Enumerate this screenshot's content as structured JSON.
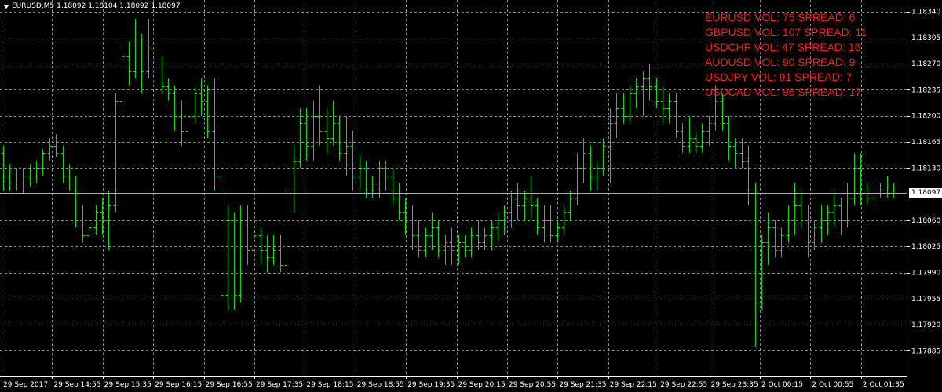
{
  "header": {
    "symbol": "EURUSD,M5",
    "ohlc": "1.18092 1.18104 1.18092 1.18097"
  },
  "overlay": [
    "EURUSD VOL: 75 SPREAD: 6",
    "GBPUSD VOL: 107 SPREAD: 11",
    "USDCHF VOL: 47 SPREAD: 16",
    "AUDUSD VOL: 90 SPREAD: 9",
    "USDJPY VOL: 91 SPREAD: 7",
    "USDCAD VOL: 96 SPREAD: 17"
  ],
  "colors": {
    "background": "#000000",
    "bars": "#00e600",
    "grid": "#8a8a8a",
    "overlay_text": "#ff1a1a",
    "axis": "#ffffff"
  },
  "chart_data": {
    "type": "bar",
    "style": "ohlc",
    "grid": true,
    "current_price": 1.18097,
    "current_price_label": "1.18097",
    "ylim": [
      1.17885,
      1.18348
    ],
    "y_ticks": [
      "1.18340",
      "1.18305",
      "1.18270",
      "1.18235",
      "1.18200",
      "1.18165",
      "1.18130",
      "1.18060",
      "1.18025",
      "1.17990",
      "1.17955",
      "1.17920",
      "1.17885"
    ],
    "x_ticks": [
      "29 Sep 2017",
      "29 Sep 14:55",
      "29 Sep 15:35",
      "29 Sep 16:15",
      "29 Sep 16:55",
      "29 Sep 17:35",
      "29 Sep 18:15",
      "29 Sep 18:55",
      "29 Sep 19:35",
      "29 Sep 20:15",
      "29 Sep 20:55",
      "29 Sep 21:35",
      "29 Sep 22:15",
      "29 Sep 22:55",
      "29 Sep 23:35",
      "2 Oct 00:15",
      "2 Oct 00:55",
      "2 Oct 01:35"
    ],
    "bars": [
      [
        1.1815,
        1.1816,
        1.181,
        1.1812
      ],
      [
        1.1812,
        1.18135,
        1.181,
        1.18125
      ],
      [
        1.18125,
        1.1813,
        1.181,
        1.1811
      ],
      [
        1.1811,
        1.1813,
        1.18095,
        1.1812
      ],
      [
        1.1812,
        1.18135,
        1.18105,
        1.18115
      ],
      [
        1.18115,
        1.1814,
        1.1811,
        1.1813
      ],
      [
        1.1813,
        1.18155,
        1.1812,
        1.1815
      ],
      [
        1.1815,
        1.1817,
        1.1814,
        1.1816
      ],
      [
        1.1816,
        1.18175,
        1.18145,
        1.1815
      ],
      [
        1.1815,
        1.1816,
        1.1811,
        1.1812
      ],
      [
        1.1812,
        1.18135,
        1.181,
        1.1811
      ],
      [
        1.1811,
        1.1812,
        1.1805,
        1.1806
      ],
      [
        1.1806,
        1.1808,
        1.1803,
        1.1804
      ],
      [
        1.1804,
        1.1806,
        1.1802,
        1.1805
      ],
      [
        1.1805,
        1.1808,
        1.1804,
        1.1807
      ],
      [
        1.1807,
        1.1809,
        1.1804,
        1.1806
      ],
      [
        1.1806,
        1.181,
        1.1802,
        1.1808
      ],
      [
        1.1808,
        1.1823,
        1.1807,
        1.1822
      ],
      [
        1.1822,
        1.1829,
        1.1821,
        1.1828
      ],
      [
        1.1828,
        1.183,
        1.1824,
        1.1826
      ],
      [
        1.1826,
        1.1833,
        1.1825,
        1.1827
      ],
      [
        1.1827,
        1.1831,
        1.1823,
        1.1826
      ],
      [
        1.1826,
        1.1833,
        1.1825,
        1.1829
      ],
      [
        1.1829,
        1.1832,
        1.1825,
        1.1827
      ],
      [
        1.1827,
        1.1828,
        1.1823,
        1.1824
      ],
      [
        1.1824,
        1.1825,
        1.1822,
        1.1823
      ],
      [
        1.1823,
        1.1824,
        1.1818,
        1.182
      ],
      [
        1.182,
        1.1822,
        1.1816,
        1.1818
      ],
      [
        1.1818,
        1.1822,
        1.1817,
        1.182
      ],
      [
        1.182,
        1.1824,
        1.1819,
        1.1823
      ],
      [
        1.1823,
        1.1825,
        1.182,
        1.1822
      ],
      [
        1.1822,
        1.1824,
        1.1817,
        1.1818
      ],
      [
        1.1818,
        1.1825,
        1.181,
        1.1812
      ],
      [
        1.1812,
        1.1814,
        1.1792,
        1.1796
      ],
      [
        1.1796,
        1.1808,
        1.1794,
        1.1806
      ],
      [
        1.1806,
        1.1807,
        1.1794,
        1.1796
      ],
      [
        1.1796,
        1.1808,
        1.1795,
        1.1806
      ],
      [
        1.1806,
        1.1808,
        1.18,
        1.1802
      ],
      [
        1.1802,
        1.1806,
        1.1799,
        1.1804
      ],
      [
        1.1804,
        1.1805,
        1.18,
        1.1802
      ],
      [
        1.1802,
        1.1804,
        1.1799,
        1.1801
      ],
      [
        1.1801,
        1.1804,
        1.18,
        1.1802
      ],
      [
        1.1802,
        1.1804,
        1.1799,
        1.18
      ],
      [
        1.18,
        1.1812,
        1.1799,
        1.181
      ],
      [
        1.181,
        1.1816,
        1.1807,
        1.1814
      ],
      [
        1.1814,
        1.1821,
        1.1813,
        1.1819
      ],
      [
        1.1819,
        1.1821,
        1.1814,
        1.1816
      ],
      [
        1.1816,
        1.1822,
        1.1814,
        1.182
      ],
      [
        1.182,
        1.1824,
        1.1816,
        1.1818
      ],
      [
        1.1818,
        1.1821,
        1.1815,
        1.1817
      ],
      [
        1.1817,
        1.1822,
        1.1816,
        1.1819
      ],
      [
        1.1819,
        1.182,
        1.1814,
        1.1815
      ],
      [
        1.1815,
        1.182,
        1.1812,
        1.1816
      ],
      [
        1.1816,
        1.1818,
        1.181,
        1.1812
      ],
      [
        1.1812,
        1.1815,
        1.181,
        1.1813
      ],
      [
        1.1813,
        1.1814,
        1.1809,
        1.181
      ],
      [
        1.181,
        1.1812,
        1.1809,
        1.1811
      ],
      [
        1.1811,
        1.1814,
        1.1809,
        1.1813
      ],
      [
        1.1813,
        1.1814,
        1.181,
        1.1812
      ],
      [
        1.1812,
        1.1813,
        1.1808,
        1.1809
      ],
      [
        1.1809,
        1.1811,
        1.1806,
        1.1807
      ],
      [
        1.1807,
        1.1809,
        1.1804,
        1.1806
      ],
      [
        1.1806,
        1.1808,
        1.1802,
        1.1804
      ],
      [
        1.1804,
        1.1806,
        1.1801,
        1.1802
      ],
      [
        1.1802,
        1.1805,
        1.1801,
        1.1804
      ],
      [
        1.1804,
        1.1807,
        1.1802,
        1.1805
      ],
      [
        1.1805,
        1.1806,
        1.1801,
        1.1802
      ],
      [
        1.1802,
        1.1804,
        1.18,
        1.1803
      ],
      [
        1.1803,
        1.1805,
        1.18,
        1.1802
      ],
      [
        1.1802,
        1.1804,
        1.18,
        1.1803
      ],
      [
        1.1803,
        1.1804,
        1.1801,
        1.1802
      ],
      [
        1.1802,
        1.1805,
        1.1801,
        1.1804
      ],
      [
        1.1804,
        1.1806,
        1.1802,
        1.1803
      ],
      [
        1.1803,
        1.1805,
        1.1802,
        1.1804
      ],
      [
        1.1804,
        1.1806,
        1.1802,
        1.1805
      ],
      [
        1.1805,
        1.1807,
        1.1803,
        1.1806
      ],
      [
        1.1806,
        1.1808,
        1.1804,
        1.1807
      ],
      [
        1.1807,
        1.181,
        1.1805,
        1.1809
      ],
      [
        1.1809,
        1.1811,
        1.1806,
        1.1808
      ],
      [
        1.1808,
        1.181,
        1.1806,
        1.1809
      ],
      [
        1.1809,
        1.1812,
        1.1806,
        1.1808
      ],
      [
        1.1808,
        1.1809,
        1.1804,
        1.1805
      ],
      [
        1.1805,
        1.1808,
        1.1803,
        1.1806
      ],
      [
        1.1806,
        1.1808,
        1.1803,
        1.1804
      ],
      [
        1.1804,
        1.1806,
        1.1803,
        1.1805
      ],
      [
        1.1805,
        1.1808,
        1.1804,
        1.1807
      ],
      [
        1.1807,
        1.181,
        1.1806,
        1.1809
      ],
      [
        1.1809,
        1.1815,
        1.1808,
        1.1813
      ],
      [
        1.1813,
        1.1817,
        1.1811,
        1.1815
      ],
      [
        1.1815,
        1.1816,
        1.181,
        1.1812
      ],
      [
        1.1812,
        1.1814,
        1.181,
        1.1813
      ],
      [
        1.1813,
        1.1817,
        1.1812,
        1.1816
      ],
      [
        1.1816,
        1.1821,
        1.1811,
        1.1819
      ],
      [
        1.1819,
        1.1823,
        1.1817,
        1.1821
      ],
      [
        1.1821,
        1.1823,
        1.1819,
        1.182
      ],
      [
        1.182,
        1.1824,
        1.1819,
        1.1823
      ],
      [
        1.1823,
        1.1825,
        1.1821,
        1.1824
      ],
      [
        1.1824,
        1.1826,
        1.182,
        1.1825
      ],
      [
        1.1825,
        1.1827,
        1.1822,
        1.1824
      ],
      [
        1.1824,
        1.1825,
        1.1821,
        1.1822
      ],
      [
        1.1822,
        1.1824,
        1.1819,
        1.1821
      ],
      [
        1.1821,
        1.1823,
        1.1819,
        1.1822
      ],
      [
        1.1822,
        1.1823,
        1.1817,
        1.1818
      ],
      [
        1.1818,
        1.1819,
        1.1815,
        1.1816
      ],
      [
        1.1816,
        1.182,
        1.1815,
        1.1817
      ],
      [
        1.1817,
        1.1818,
        1.1815,
        1.1816
      ],
      [
        1.1816,
        1.1819,
        1.1815,
        1.1818
      ],
      [
        1.1818,
        1.182,
        1.1816,
        1.1819
      ],
      [
        1.1819,
        1.1824,
        1.1818,
        1.1822
      ],
      [
        1.1822,
        1.1823,
        1.1818,
        1.1819
      ],
      [
        1.1819,
        1.182,
        1.1814,
        1.1816
      ],
      [
        1.1816,
        1.1817,
        1.1813,
        1.1815
      ],
      [
        1.1815,
        1.1817,
        1.1813,
        1.1814
      ],
      [
        1.1814,
        1.1816,
        1.1808,
        1.181
      ],
      [
        1.181,
        1.1811,
        1.1789,
        1.1795
      ],
      [
        1.1795,
        1.1804,
        1.1794,
        1.1803
      ],
      [
        1.1803,
        1.1807,
        1.18,
        1.1805
      ],
      [
        1.1805,
        1.1806,
        1.1801,
        1.1802
      ],
      [
        1.1802,
        1.1805,
        1.1801,
        1.1804
      ],
      [
        1.1804,
        1.1808,
        1.1803,
        1.1806
      ],
      [
        1.1806,
        1.1811,
        1.1804,
        1.1808
      ],
      [
        1.1808,
        1.181,
        1.1805,
        1.1806
      ],
      [
        1.1806,
        1.1808,
        1.1801,
        1.1803
      ],
      [
        1.1803,
        1.1806,
        1.1802,
        1.1805
      ],
      [
        1.1805,
        1.1808,
        1.1803,
        1.1806
      ],
      [
        1.1806,
        1.1808,
        1.1804,
        1.1807
      ],
      [
        1.1807,
        1.181,
        1.1805,
        1.1808
      ],
      [
        1.1808,
        1.1809,
        1.1804,
        1.1806
      ],
      [
        1.1806,
        1.1811,
        1.1805,
        1.1809
      ],
      [
        1.1809,
        1.1815,
        1.1808,
        1.1813
      ],
      [
        1.1813,
        1.1815,
        1.1808,
        1.181
      ],
      [
        1.181,
        1.1811,
        1.1808,
        1.1809
      ],
      [
        1.1809,
        1.1812,
        1.1808,
        1.181
      ],
      [
        1.181,
        1.1811,
        1.1809,
        1.1811
      ],
      [
        1.1811,
        1.1812,
        1.1809,
        1.181
      ],
      [
        1.181,
        1.1811,
        1.1809,
        1.18097
      ]
    ]
  }
}
